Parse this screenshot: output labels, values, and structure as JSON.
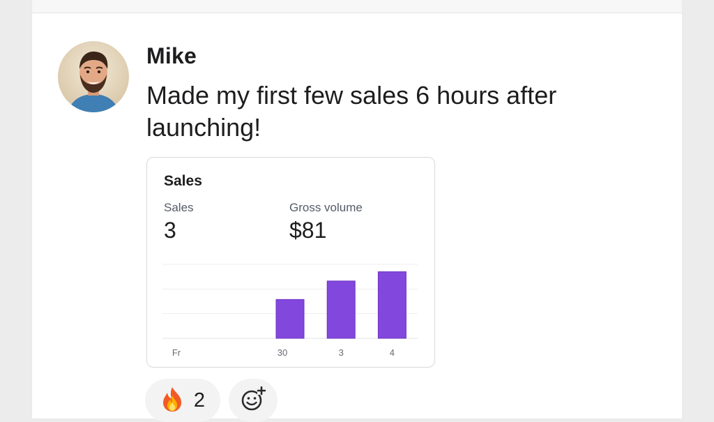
{
  "post": {
    "author": "Mike",
    "text": "Made my first few sales 6 hours after launching!"
  },
  "card": {
    "title": "Sales",
    "stats": [
      {
        "label": "Sales",
        "value": "3"
      },
      {
        "label": "Gross volume",
        "value": "$81"
      }
    ]
  },
  "chart_data": {
    "type": "bar",
    "categories": [
      "Fr",
      "30",
      "3",
      "4"
    ],
    "values": [
      0,
      0,
      2.1,
      3.1,
      3.6
    ],
    "ylim": [
      0,
      4
    ],
    "grid": true,
    "color": "#8247dc"
  },
  "reactions": {
    "fire": {
      "icon": "fire-emoji",
      "count": "2"
    },
    "add": {
      "icon": "add-reaction-icon"
    }
  },
  "colors": {
    "accent": "#8247dc",
    "reaction_bg": "#f3f3f3",
    "text": "#1d1d1f"
  }
}
